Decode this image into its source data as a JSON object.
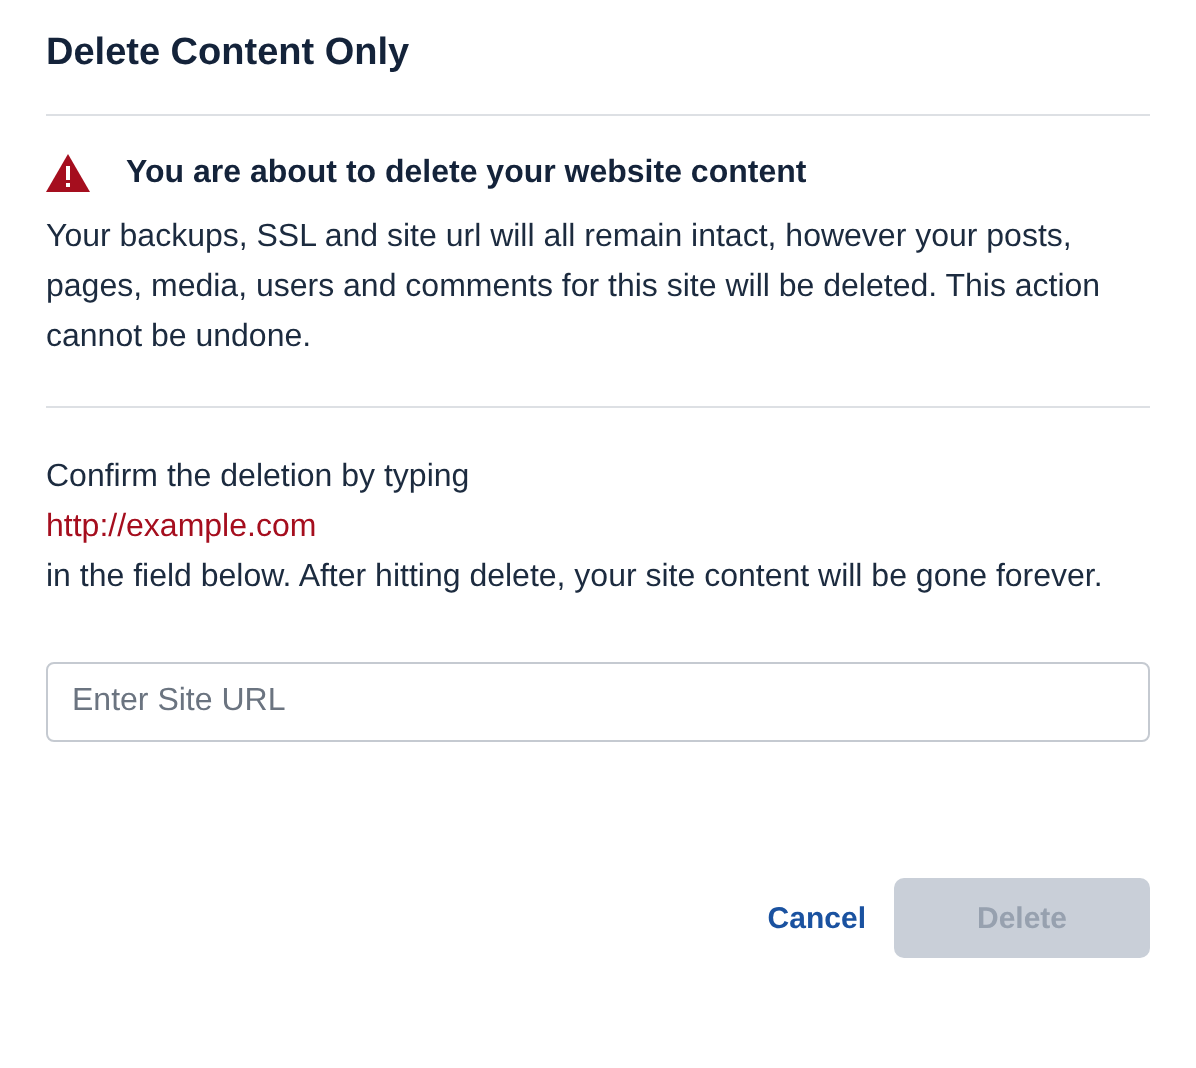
{
  "dialog": {
    "title": "Delete Content Only"
  },
  "warning": {
    "heading": "You are about to delete your website content",
    "body": "Your backups, SSL and site url will all remain intact, however your posts, pages, media, users and comments for this site will be deleted. This action cannot be undone."
  },
  "confirm": {
    "lead": "Confirm the deletion by typing",
    "url": "http://example.com",
    "tail": "in the field below. After hitting delete, your site content will be gone forever."
  },
  "field": {
    "placeholder": "Enter Site URL"
  },
  "buttons": [
    {
      "label": "Cancel",
      "kind": "link",
      "disabled": false
    },
    {
      "label": "Delete",
      "kind": "primary",
      "disabled": true
    }
  ]
}
